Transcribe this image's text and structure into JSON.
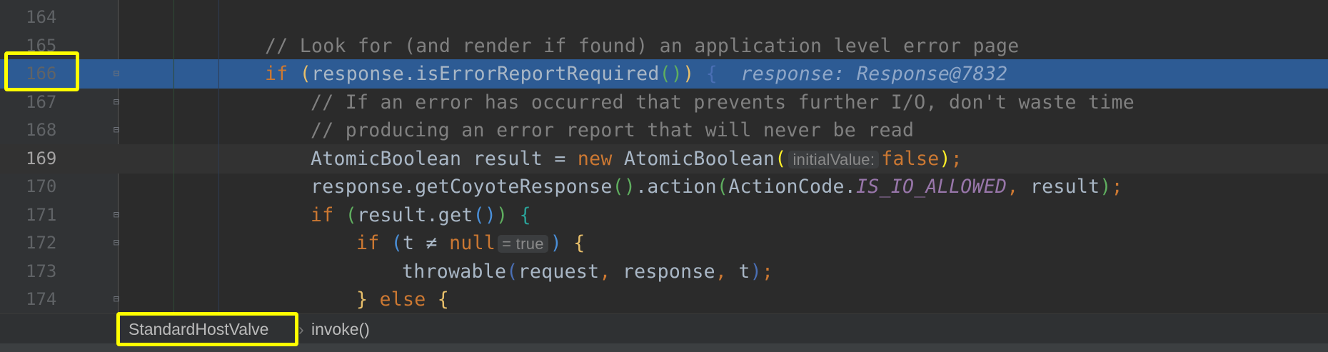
{
  "colors": {
    "keyword": "#cc7832",
    "text": "#a9b7c6",
    "comment": "#808080",
    "constant": "#9876aa",
    "highlight": "#2d5b94",
    "annotation": "#ffff00"
  },
  "lines": [
    {
      "num": "164",
      "indent": 0,
      "tokens": []
    },
    {
      "num": "165",
      "indent": 0,
      "tokens": [
        {
          "t": "// Look for (and render if found) an application level error page",
          "c": "#808080"
        }
      ]
    },
    {
      "num": "166",
      "indent": 0,
      "hl": true,
      "fold": "end",
      "tokens": [
        {
          "t": "if ",
          "c": "#cc7832"
        },
        {
          "t": "(",
          "c": "#e8bf6a"
        },
        {
          "t": "response.isErrorReportRequired",
          "c": "#a9b7c6"
        },
        {
          "t": "()",
          "c": "#5fae5f"
        },
        {
          "t": ")",
          "c": "#e8bf6a"
        },
        {
          "t": " { ",
          "c": "#4a6fb5"
        },
        {
          "t": " response: Response@7832",
          "k": "inline"
        }
      ]
    },
    {
      "num": "167",
      "indent": 1,
      "fold": "start",
      "tokens": [
        {
          "t": "// If an error has occurred that prevents further I/O, don't waste time",
          "c": "#808080"
        }
      ]
    },
    {
      "num": "168",
      "indent": 1,
      "fold": "end",
      "tokens": [
        {
          "t": "// producing an error report that will never be read",
          "c": "#808080"
        }
      ]
    },
    {
      "num": "169",
      "indent": 1,
      "caret": true,
      "tokens": [
        {
          "t": "AtomicBoolean result = ",
          "c": "#a9b7c6"
        },
        {
          "t": "new ",
          "c": "#cc7832"
        },
        {
          "t": "AtomicBoolean",
          "c": "#a9b7c6"
        },
        {
          "t": "(",
          "c": "#ffef28"
        },
        {
          "t": "initialValue:",
          "k": "hint"
        },
        {
          "t": "false",
          "c": "#cc7832"
        },
        {
          "t": ")",
          "c": "#ffef28"
        },
        {
          "t": ";",
          "c": "#cc7832"
        }
      ]
    },
    {
      "num": "170",
      "indent": 1,
      "tokens": [
        {
          "t": "response.getCoyoteResponse",
          "c": "#a9b7c6"
        },
        {
          "t": "()",
          "c": "#5fae5f"
        },
        {
          "t": ".action",
          "c": "#a9b7c6"
        },
        {
          "t": "(",
          "c": "#5fae5f"
        },
        {
          "t": "ActionCode.",
          "c": "#a9b7c6"
        },
        {
          "t": "IS_IO_ALLOWED",
          "c": "#9876aa",
          "i": true
        },
        {
          "t": ", ",
          "c": "#cc7832"
        },
        {
          "t": "result",
          "c": "#a9b7c6"
        },
        {
          "t": ")",
          "c": "#5fae5f"
        },
        {
          "t": ";",
          "c": "#cc7832"
        }
      ]
    },
    {
      "num": "171",
      "indent": 1,
      "fold": "start",
      "tokens": [
        {
          "t": "if ",
          "c": "#cc7832"
        },
        {
          "t": "(",
          "c": "#5fae5f"
        },
        {
          "t": "result.get",
          "c": "#a9b7c6"
        },
        {
          "t": "()",
          "c": "#4a8fd8"
        },
        {
          "t": ")",
          "c": "#5fae5f"
        },
        {
          "t": " {",
          "c": "#2aa198"
        }
      ]
    },
    {
      "num": "172",
      "indent": 2,
      "fold": "start",
      "tokens": [
        {
          "t": "if ",
          "c": "#cc7832"
        },
        {
          "t": "(",
          "c": "#4a8fd8"
        },
        {
          "t": "t ≠ ",
          "c": "#a9b7c6"
        },
        {
          "t": "null",
          "c": "#cc7832"
        },
        {
          "t": "= true",
          "k": "hint"
        },
        {
          "t": ")",
          "c": "#4a8fd8"
        },
        {
          "t": " {",
          "c": "#e8bf6a"
        }
      ]
    },
    {
      "num": "173",
      "indent": 3,
      "tokens": [
        {
          "t": "throwable",
          "c": "#a9b7c6"
        },
        {
          "t": "(",
          "c": "#4a6fb5"
        },
        {
          "t": "request",
          "c": "#a9b7c6"
        },
        {
          "t": ", ",
          "c": "#cc7832"
        },
        {
          "t": "response",
          "c": "#a9b7c6"
        },
        {
          "t": ", ",
          "c": "#cc7832"
        },
        {
          "t": "t",
          "c": "#a9b7c6"
        },
        {
          "t": ")",
          "c": "#4a6fb5"
        },
        {
          "t": ";",
          "c": "#cc7832"
        }
      ]
    },
    {
      "num": "174",
      "indent": 2,
      "fold": "end",
      "tokens": [
        {
          "t": "} ",
          "c": "#e8bf6a"
        },
        {
          "t": "else ",
          "c": "#cc7832"
        },
        {
          "t": "{",
          "c": "#e8bf6a"
        }
      ]
    }
  ],
  "breadcrumb": {
    "class_name": "StandardHostValve",
    "separator": "›",
    "method": "invoke()"
  }
}
